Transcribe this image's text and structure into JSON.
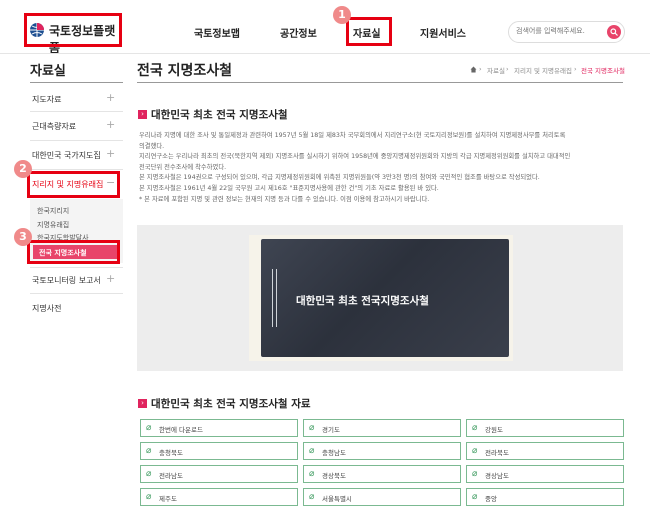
{
  "header": {
    "logo_text": "국토정보플랫폼",
    "nav": [
      "국토정보맵",
      "공간정보",
      "자료실",
      "지원서비스"
    ],
    "search_placeholder": "검색어를 입력해주세요."
  },
  "badges": [
    "1",
    "2",
    "3"
  ],
  "sidebar": {
    "title": "자료실",
    "items": [
      "지도자료",
      "근대측량자료",
      "대한민국 국가지도집",
      "지리지 및 지명유래집",
      "국토모니터링 보고서",
      "지명사전"
    ],
    "expand_symbols": [
      "+",
      "−"
    ],
    "subitems": [
      "한국지리지",
      "지명유래집",
      "한국지도학발달사",
      "전국 지명조사철"
    ]
  },
  "main": {
    "page_title": "전국 지명조사철",
    "breadcrumb": [
      "자료실",
      "지리지 및 지명유래집",
      "전국 지명조사철"
    ],
    "section1_title": "대한민국 최초 전국 지명조사철",
    "paragraphs": [
      "우리나라 지명에 대한 조사 및 통일제정과 관련하여 1957년 5월 18일 제83차 국무회의에서 지리연구소(현 국토지리정보원)를 설치하여 지명제정사무를 처리토록",
      "의결했다.",
      "지리연구소는 우리나라 최초의 전국(북한지역 제외) 지명조사를 실시하기 위하여 1958년에 중앙지명제정위원회와 지방의 각급 지명제정위원회를 설치하고 대대적인",
      "전국단위 전수조사에 착수하였다.",
      "본 지명조사철은 194권으로 구성되어 있으며, 각급 지명제정위원회에 위촉된 지명위원들(약 3만3천 명)의 참여와 국민적인 협조를 바탕으로 작성되었다.",
      "본 지명조사철은 1961년 4월 22일 국무원 고시 제16호 \"표준지명사용에 관한 건\"의 기초 자료로 활용된 바 있다.",
      "* 본 자료에 포함된 지명 및 관련 정보는 현재의 지명 등과 다를 수 있습니다. 이점 이용에 참고하시기 바랍니다."
    ],
    "image_caption": "대한민국 최초 전국지명조사철",
    "section2_title": "대한민국 최초 전국 지명조사철 자료",
    "downloads": [
      "한번에 다운로드",
      "경기도",
      "강원도",
      "충청북도",
      "충청남도",
      "전라북도",
      "전라남도",
      "경상북도",
      "경상남도",
      "제주도",
      "서울특별시",
      "중앙"
    ]
  },
  "colors": {
    "highlight": "#e60012",
    "accent": "#e0245e",
    "download_border": "#7bb991"
  },
  "icons": {
    "logo": "globe-logo-icon",
    "search": "search-icon",
    "home": "home-icon",
    "download": "paperclip-icon"
  }
}
